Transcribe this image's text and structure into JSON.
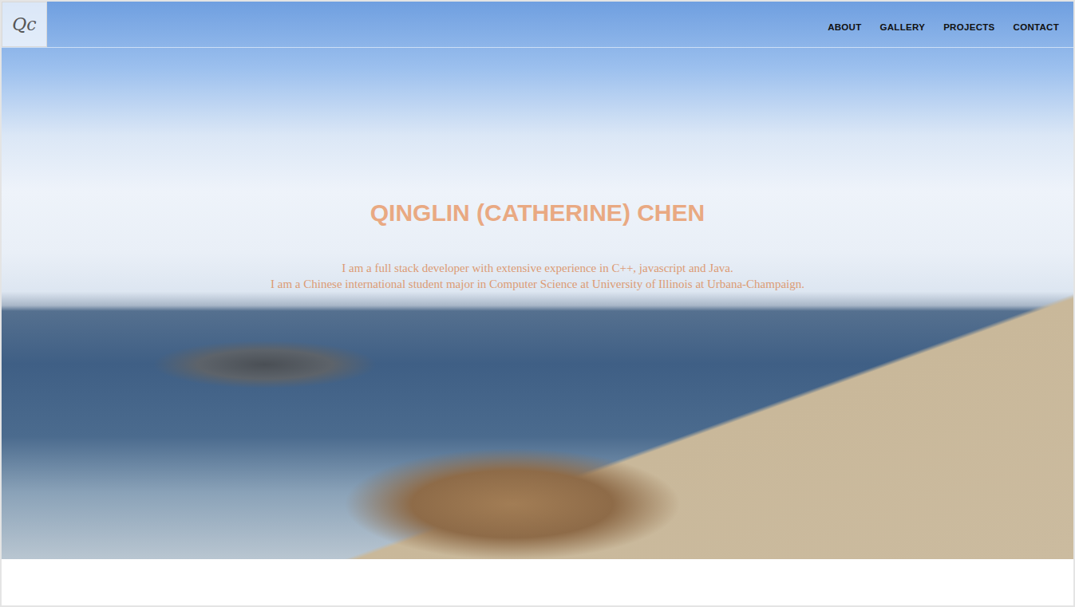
{
  "logo": "Qc",
  "nav": [
    {
      "label": "ABOUT"
    },
    {
      "label": "GALLERY"
    },
    {
      "label": "PROJECTS"
    },
    {
      "label": "CONTACT"
    }
  ],
  "hero": {
    "title": "QINGLIN (CATHERINE) CHEN",
    "lines": [
      "I am a full stack developer with extensive experience in C++, javascript and Java.",
      "I am a Chinese international student major in Computer Science at University of Illinois at Urbana-Champaign."
    ]
  }
}
